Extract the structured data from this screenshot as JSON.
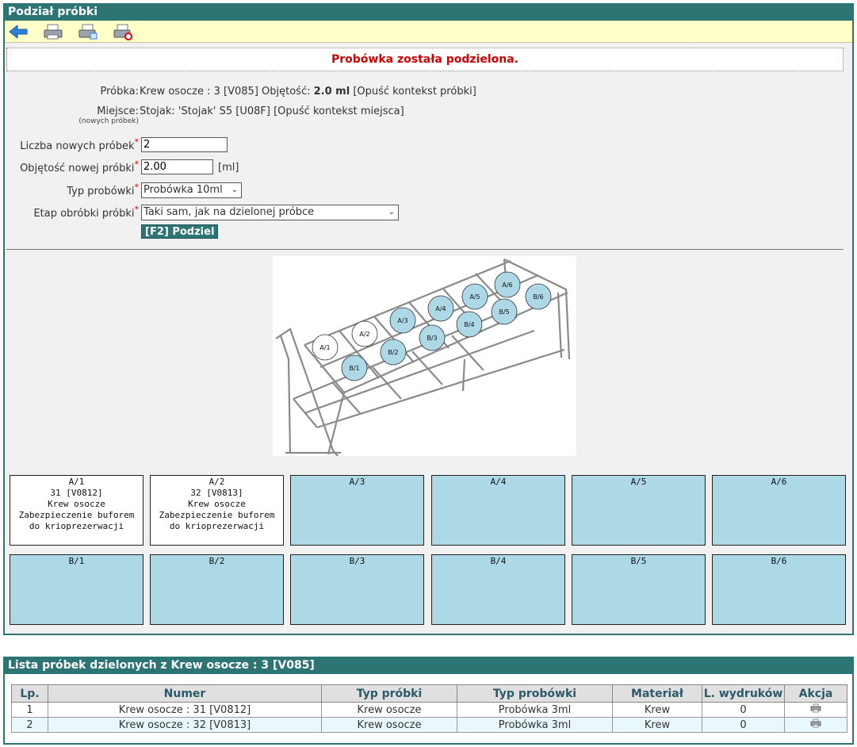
{
  "header": {
    "title": "Podział próbki"
  },
  "toolbar": {
    "icons": [
      "back-arrow-icon",
      "printer-icon",
      "printer-preview-icon",
      "printer-delete-icon"
    ]
  },
  "message": "Probówka została podzielona.",
  "form": {
    "sample_label": "Próbka:",
    "sample_text": "Krew osocze : 3 [V085] Objętość:",
    "sample_volume": "2.0 ml",
    "sample_leave": "[Opuść kontekst próbki]",
    "place_label": "Miejsce:",
    "place_note": "(nowych próbek)",
    "place_text": "Stojak: 'Stojak' S5 [U08F]",
    "place_leave": "[Opuść kontekst miejsca]",
    "count_label": "Liczba nowych próbek",
    "count_value": "2",
    "volume_label": "Objętość nowej próbki",
    "volume_value": "2.00",
    "volume_unit": "[ml]",
    "tube_label": "Typ probówki",
    "tube_value": "Probówka 10ml",
    "stage_label": "Etap obróbki próbki",
    "stage_value": "Taki sam, jak na dzielonej próbce",
    "required_mark": "*",
    "split_button": "[F2] Podziel"
  },
  "rack_labels": {
    "a1": "A/1",
    "a2": "A/2",
    "a3": "A/3",
    "a4": "A/4",
    "a5": "A/5",
    "a6": "A/6",
    "b1": "B/1",
    "b2": "B/2",
    "b3": "B/3",
    "b4": "B/4",
    "b5": "B/5",
    "b6": "B/6"
  },
  "slots": {
    "row_a": [
      {
        "pos": "A/1",
        "number": "31 [V0812]",
        "material": "Krew osocze",
        "desc1": "Zabezpieczenie buforem",
        "desc2": "do krioprezerwacji"
      },
      {
        "pos": "A/2",
        "number": "32 [V0813]",
        "material": "Krew osocze",
        "desc1": "Zabezpieczenie buforem",
        "desc2": "do krioprezerwacji"
      },
      {
        "pos": "A/3"
      },
      {
        "pos": "A/4"
      },
      {
        "pos": "A/5"
      },
      {
        "pos": "A/6"
      }
    ],
    "row_b": [
      {
        "pos": "B/1"
      },
      {
        "pos": "B/2"
      },
      {
        "pos": "B/3"
      },
      {
        "pos": "B/4"
      },
      {
        "pos": "B/5"
      },
      {
        "pos": "B/6"
      }
    ]
  },
  "list": {
    "title": "Lista próbek dzielonych z Krew osocze : 3 [V085]",
    "columns": [
      "Lp.",
      "Numer",
      "Typ próbki",
      "Typ probówki",
      "Materiał",
      "L. wydruków",
      "Akcja"
    ],
    "rows": [
      {
        "lp": "1",
        "numer": "Krew osocze : 31 [V0812]",
        "typ_probki": "Krew osocze",
        "typ_probowki": "Probówka 3ml",
        "material": "Krew",
        "wydruki": "0"
      },
      {
        "lp": "2",
        "numer": "Krew osocze : 32 [V0813]",
        "typ_probki": "Krew osocze",
        "typ_probowki": "Probówka 3ml",
        "material": "Krew",
        "wydruki": "0"
      }
    ]
  },
  "colors": {
    "header_bg": "#2d7474",
    "toolbar_bg": "#ffffc8",
    "message_text": "#d00000",
    "empty_slot": "#add8e6",
    "filled_slot": "#ffffff"
  }
}
